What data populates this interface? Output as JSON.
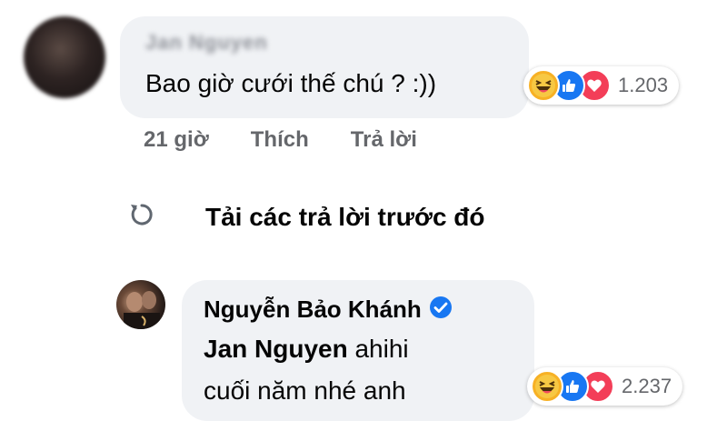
{
  "comment": {
    "author_name": "Jan Nguyen",
    "text": "Bao giờ cưới thế chú ? :))",
    "reactions": {
      "icons": [
        "haha-icon",
        "like-icon",
        "love-icon"
      ],
      "count": "1.203"
    },
    "time": "21 giờ",
    "like_label": "Thích",
    "reply_label": "Trả lời"
  },
  "load_previous": {
    "icon": "refresh-icon",
    "label": "Tải các trả lời trước đó"
  },
  "reply": {
    "author_name": "Nguyễn Bảo Khánh",
    "verified": true,
    "mention": "Jan Nguyen",
    "text_after_mention": " ahihi",
    "text_line2": "cuối năm nhé anh",
    "reactions": {
      "icons": [
        "haha-icon",
        "like-icon",
        "love-icon"
      ],
      "count": "2.237"
    }
  },
  "colors": {
    "bubble": "#f0f2f5",
    "secondary_text": "#65676b",
    "primary_text": "#050505",
    "like_blue": "#1877f2",
    "love_red": "#f33e58",
    "haha_yellow": "#f7b125",
    "verified_blue": "#1877f2"
  }
}
